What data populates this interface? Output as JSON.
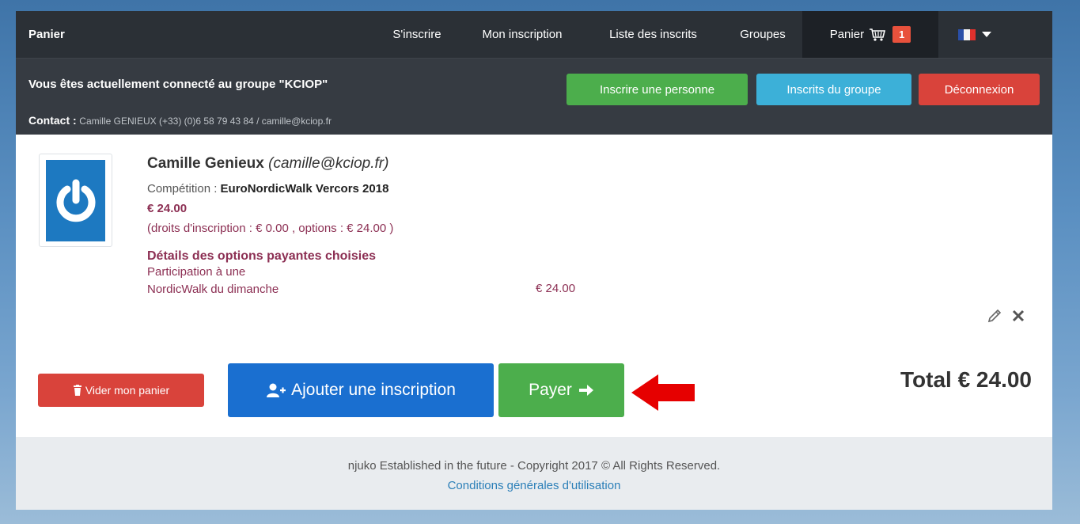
{
  "nav": {
    "brand": "Panier",
    "items": [
      {
        "label": "S'inscrire"
      },
      {
        "label": "Mon inscription"
      },
      {
        "label": "Liste des inscrits"
      },
      {
        "label": "Groupes"
      }
    ],
    "cart_label": "Panier",
    "cart_count": "1",
    "language": "fr-flag"
  },
  "subheader": {
    "group_text": "Vous êtes actuellement connecté au groupe \"KCIOP\"",
    "contact_label": "Contact :",
    "contact_info": "Camille GENIEUX (+33) (0)6 58 79 43 84 / camille@kciop.fr",
    "btn_add_person": "Inscrire une personne",
    "btn_group_members": "Inscrits du groupe",
    "btn_logout": "Déconnexion"
  },
  "entry": {
    "name": "Camille Genieux",
    "email": "(camille@kciop.fr)",
    "competition_label": "Compétition :",
    "competition_name": "EuroNordicWalk Vercors 2018",
    "price": "€ 24.00",
    "breakdown": "(droits d'inscription : € 0.00 , options : € 24.00 )",
    "options_title": "Détails des options payantes choisies",
    "option_line1": "Participation à une",
    "option_line2": "NordicWalk du dimanche",
    "option_amount": "€ 24.00"
  },
  "actions": {
    "empty_cart": "Vider mon panier",
    "add_registration": "Ajouter une inscription",
    "pay": "Payer",
    "total": "Total € 24.00"
  },
  "footer": {
    "copyright": "njuko Established in the future - Copyright 2017 © All Rights Reserved.",
    "terms": "Conditions générales d'utilisation"
  },
  "colors": {
    "nav_bg": "#2b3036",
    "subheader_bg": "#363b42",
    "green": "#4cae4c",
    "cyan": "#3cb0d8",
    "red": "#d9433b",
    "blue": "#1a6fd0",
    "accent_text": "#8c2f53",
    "arrow": "#e60000"
  }
}
